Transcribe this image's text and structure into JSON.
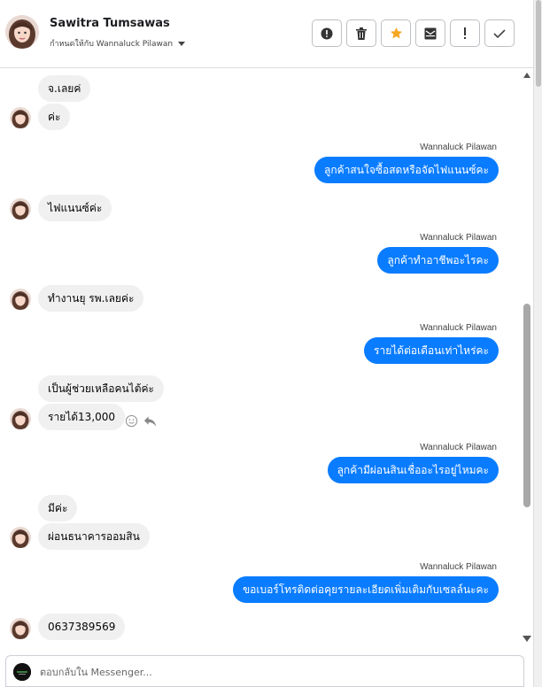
{
  "header": {
    "contact_name": "Sawitra Tumsawas",
    "assigned_to_label": "กำหนดให้กับ Wannaluck Pilawan",
    "toolbar": [
      {
        "name": "spam-button",
        "icon": "alert-circle-icon"
      },
      {
        "name": "delete-button",
        "icon": "trash-icon"
      },
      {
        "name": "star-button",
        "icon": "star-icon"
      },
      {
        "name": "mark-unread-button",
        "icon": "envelope-icon"
      },
      {
        "name": "follow-up-button",
        "icon": "exclamation-icon"
      },
      {
        "name": "done-button",
        "icon": "check-icon"
      }
    ]
  },
  "thread": {
    "sender_name": "Wannaluck Pilawan",
    "messages": [
      {
        "dir": "in",
        "text": "จ.เลยค่"
      },
      {
        "dir": "in",
        "text": "ค่ะ"
      },
      {
        "dir": "out",
        "text": "ลูกค้าสนใจซื้อสดหรือจัดไฟแนนซ์คะ"
      },
      {
        "dir": "in",
        "text": "ไฟแนนซ์ค่ะ"
      },
      {
        "dir": "out",
        "text": "ลูกค้าทำอาชีพอะไรคะ"
      },
      {
        "dir": "in",
        "text": "ทำงานยุ รพ.เลยค่ะ"
      },
      {
        "dir": "out",
        "text": "รายได้ต่อเดือนเท่าไหร่คะ"
      },
      {
        "dir": "in",
        "text": "เป็นผู้ช่วยเหลือคนไต้ค่ะ"
      },
      {
        "dir": "in",
        "text": "รายได้13,000"
      },
      {
        "dir": "out",
        "text": "ลูกค้ามีผ่อนสินเชื่ออะไรอยู่ไหมคะ"
      },
      {
        "dir": "in",
        "text": "มีค่ะ"
      },
      {
        "dir": "in",
        "text": "ผ่อนธนาคารออมสิน"
      },
      {
        "dir": "out",
        "text": "ขอเบอร์โทรติดต่อคุยรายละเอียดเพิ่มเติมกับเซลล์นะคะ"
      },
      {
        "dir": "in",
        "text": "0637389569"
      }
    ]
  },
  "composer": {
    "placeholder": "ตอบกลับใน Messenger..."
  },
  "colors": {
    "outgoing_bubble": "#0a7cff",
    "incoming_bubble": "#f0f0f0",
    "star": "#f5a623"
  }
}
